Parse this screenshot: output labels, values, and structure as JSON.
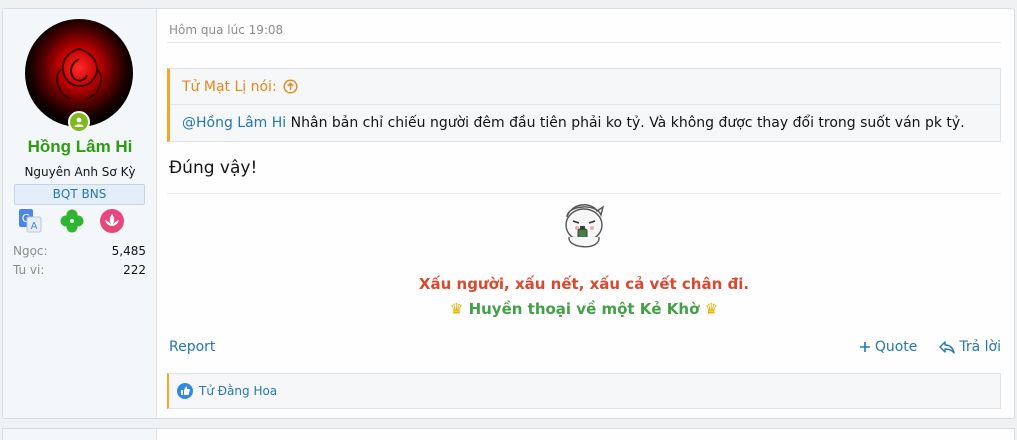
{
  "user": {
    "name": "Hồng Lâm Hi",
    "title": "Nguyên Anh Sơ Kỳ",
    "banner": "BQT BNS",
    "avatar_icon": "red-rose-avatar",
    "online_icon": "online-status-icon",
    "badges": [
      "translate-icon",
      "clover-icon",
      "lotus-icon"
    ],
    "stats": [
      {
        "key": "Ngọc:",
        "value": "5,485"
      },
      {
        "key": "Tu vi:",
        "value": "222"
      }
    ]
  },
  "post": {
    "timestamp": "Hôm qua lúc 19:08",
    "quote": {
      "author_text": "Tử Mạt Lị nói:",
      "jump_icon": "arrow-up-circle-icon",
      "mention": "@Hồng Lâm Hi",
      "text": " Nhân bản chỉ chiếu người đêm đầu tiên phải ko tỷ. Và không được thay đổi trong suốt ván pk tỷ."
    },
    "message": "Đúng vậy!",
    "signature": {
      "sticker_icon": "cartoon-sticker-icon",
      "line1": "Xấu người, xấu nết, xấu cả vết chân đi.",
      "crown": "♛",
      "line2": "Huyền thoại về một Kẻ Khờ"
    },
    "actions": {
      "report": "Report",
      "quote": "Quote",
      "reply": "Trả lời"
    },
    "reactions": {
      "icon": "like-icon",
      "text": "Tử Đằng Hoa"
    }
  },
  "colors": {
    "username": "#2e9b11",
    "link": "#2577b1",
    "quote_accent": "#f7a626",
    "signature_red": "#d8492f",
    "signature_green": "#43a047"
  }
}
